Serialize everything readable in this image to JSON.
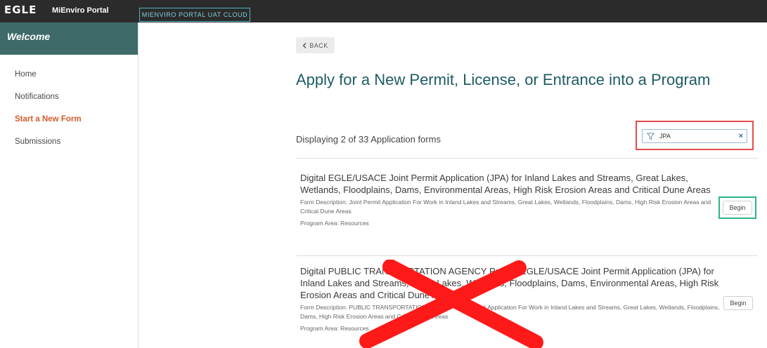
{
  "topbar": {
    "logo": "EGLE",
    "portal_name": "MiEnviro Portal",
    "environment": "MIENVIRO PORTAL UAT CLOUD"
  },
  "sidebar": {
    "welcome": "Welcome",
    "items": [
      {
        "label": "Home"
      },
      {
        "label": "Notifications"
      },
      {
        "label": "Start a New Form"
      },
      {
        "label": "Submissions"
      }
    ]
  },
  "main": {
    "back_label": "BACK",
    "title": "Apply for a New Permit, License, or Entrance into a Program",
    "display_count": "Displaying 2 of 33 Application forms",
    "filter": {
      "value": "JPA",
      "clear": "×"
    },
    "forms": [
      {
        "title": "Digital EGLE/USACE Joint Permit Application (JPA) for Inland Lakes and Streams, Great Lakes, Wetlands, Floodplains, Dams, Environmental Areas, High Risk Erosion Areas and Critical Dune Areas",
        "description": "Form Description: Joint Permit Application For Work in Inland Lakes and Streams, Great Lakes, Wetlands, Floodplains, Dams, High Risk Erosion Areas and Critical Dune Areas",
        "program_area": "Program Area: Resources",
        "begin_label": "Begin"
      },
      {
        "title": "Digital PUBLIC TRANSPORTATION AGENCY Project EGLE/USACE Joint Permit Application (JPA) for Inland Lakes and Streams, Great Lakes, Wetlands, Floodplains, Dams, Environmental Areas, High Risk Erosion Areas and Critical Dune Areas",
        "description": "Form Description: PUBLIC TRANSPORTATION AGENCY Joint Permit Application For Work in Inland Lakes and Streams, Great Lakes, Wetlands, Floodplains, Dams, High Risk Erosion Areas and Critical Dune Areas",
        "program_area": "Program Area: Resources",
        "begin_label": "Begin"
      }
    ]
  },
  "colors": {
    "accent_teal": "#1d5c63",
    "active_nav": "#d35a2a",
    "highlight_red": "#e64b4b",
    "highlight_green": "#2db38a",
    "cross_red": "#ff1a1a"
  }
}
